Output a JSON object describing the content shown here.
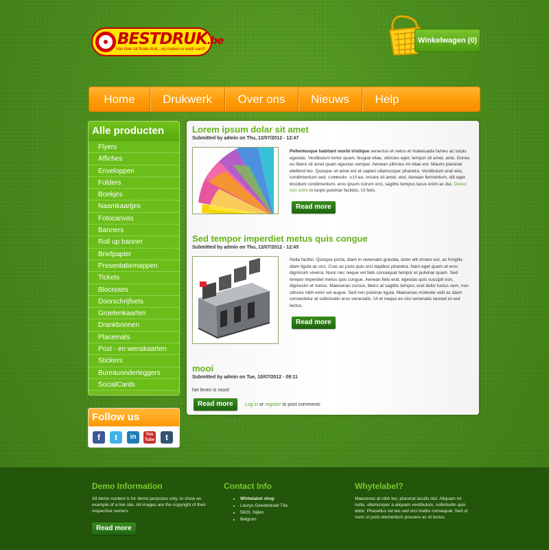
{
  "logo": {
    "brand": "BESTDRUK",
    "tld": ".be",
    "tagline": "Van idee tot finale druk...wij maken er werk van!!!"
  },
  "cart": {
    "label": "Winkelwagen (0)"
  },
  "nav": {
    "items": [
      "Home",
      "Drukwerk",
      "Over ons",
      "Nieuws",
      "Help"
    ]
  },
  "sidebar": {
    "title": "Alle producten",
    "items": [
      "Flyers",
      "Affiches",
      "Enveloppen",
      "Folders",
      "Boekjes",
      "Naamkaartjes",
      "Fotocanvas",
      "Banners",
      "Roll up banner",
      "Briefpapier",
      "Presentatiemappen",
      "Tickets",
      "Blocnotes",
      "Doorschrijfsets",
      "Groetenkaarten",
      "Drankbonnen",
      "Placemats",
      "Post - en wenskaarten",
      "Stickers",
      "Bureauonderleggers",
      "SocialCards"
    ]
  },
  "follow": {
    "title": "Follow us",
    "icons": [
      "f",
      "t",
      "in",
      "You Tube",
      "t"
    ]
  },
  "posts": [
    {
      "title": "Lorem ipsum dolar sit amet",
      "meta": "Submitted by admin on Thu, 12/07/2012 - 12:47",
      "body_bold": "Pellentesque habitant morbi tristique",
      "body": " senectus et netus et malesuada fames ac turpis egestas. Vestibulum tortor quam, feugiat vitae, ultricies eget, tempor sit amet, ante. Donec eu libero sit amet quam egestas semper. Aenean ultricies mi vitae est. Mauris placerat eleifend leo. Quisque sit amet est et sapien ullamcorper pharetra. Vestibulum erat wisi, condimentum sed, ",
      "body_code": "commodo vitae",
      "body2": ", ornare sit amet, wisi. Aenean fermentum, elit eget tincidunt condimentum, eros ipsum rutrum orci, sagittis tempus lacus enim ac dui. ",
      "body_link": "Donec non enim",
      "body3": " in turpis pulvinar facilisis. Ut felis.",
      "read_more": "Read more"
    },
    {
      "title": "Sed tempor imperdiet metus quis congue",
      "meta": "Submitted by admin on Thu, 12/07/2012 - 12:45",
      "body": "Nulla facilisi. Quisque porta, diam in venenatis gravida, dolor elit ornare est, ac fringilla diam ligula ac orci. Cras ac justo quis orci dapibus pharetra. Nam eget quam at eros dignissim viverra. Nunc nec neque vel felis consequat tempor et pulvinar quam. Sed tempor imperdiet metus quis congue. Aenean felis erat, egestas quis suscipit non, dignissim et metus. Maecenas cursus, libero at sagittis tempor, erat dolor luctus sem, non ultrices nibh enim vel augue. Sed non pulvinar ligula. Maecenas molestie velit ac diam consectetur at sollicitudin eros venenatis. Ut et neque eu nisi venenatis laoreet id sed lectus.",
      "read_more": "Read more"
    },
    {
      "title": "mooi",
      "meta": "Submitted by admin on Tue, 10/07/2012 - 09:11",
      "body": "het leven is mooi!",
      "read_more": "Read more",
      "login": "Log in",
      "or": " or ",
      "register": "register",
      "comment": " to post comments"
    }
  ],
  "footer": {
    "demo": {
      "title": "Demo Information",
      "text": "All demo content is for demo purposes only, to show an example of a live site. All images are the copyright of their respective owners.",
      "read_more": "Read more"
    },
    "contact": {
      "title": "Contact Info",
      "items": [
        "Whitelabel shop",
        "Laurys Gewatstraat 73a",
        "5620, Nijlen",
        "Belgium"
      ]
    },
    "whyte": {
      "title": "Whytelabel?",
      "text": "Maecenas at nibh leo, placerat iaculis nisl. Aliquam mi nulla, ullamcorper a aliquam vestibulum, sollicitudin quis dolor. Phasellus vel leo sed orci mattis consequat. Sed ut nunc ut justo elementum posuere ac et lectus."
    }
  }
}
